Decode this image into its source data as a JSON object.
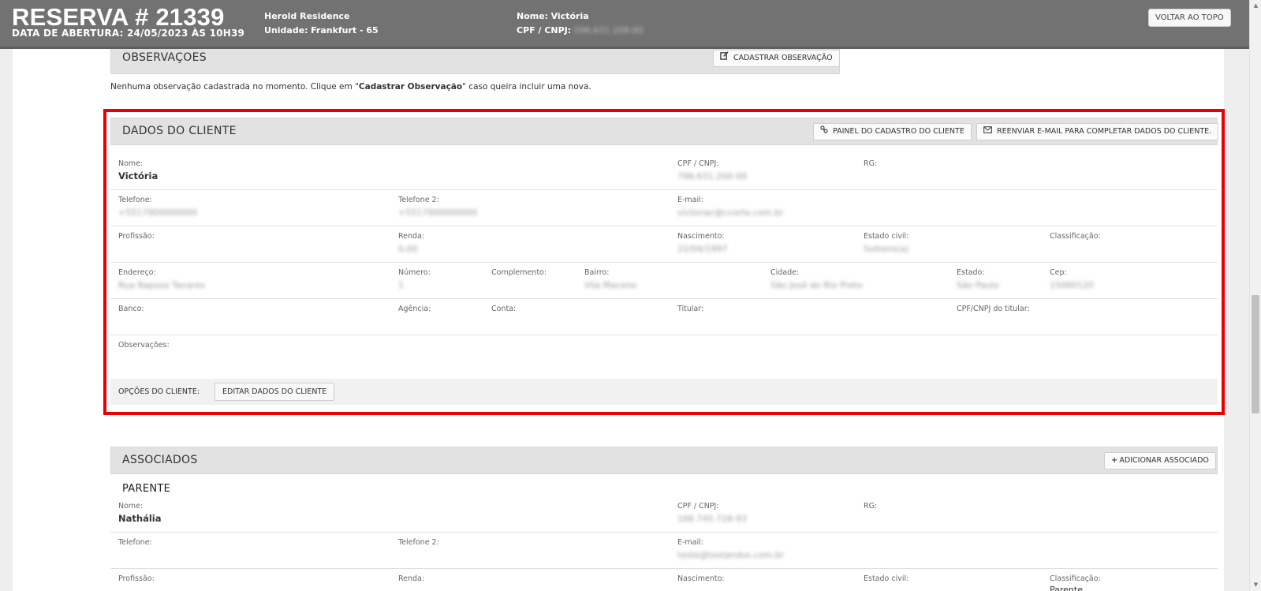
{
  "header": {
    "title": "RESERVA # 21339",
    "opened": "DATA DE ABERTURA: 24/05/2023 ÀS 10H39",
    "residence": "Herold Residence",
    "unit_label": "Unidade:",
    "unit_value": "Frankfurt - 65",
    "name_label": "Nome:",
    "name_value": "Victória",
    "cpf_label": "CPF / CNPJ:",
    "cpf_value": "096.631.208-80",
    "back_to_top": "VOLTAR AO TOPO"
  },
  "observacoes": {
    "title": "OBSERVAÇOES",
    "register_button": "CADASTRAR OBSERVAÇÃO",
    "note_prefix": "Nenhuma observação cadastrada no momento. Clique em \"",
    "note_bold": "Cadastrar Observação",
    "note_suffix": "\" caso queira incluir uma nova."
  },
  "client": {
    "title": "DADOS DO CLIENTE",
    "panel_button": "PAINEL DO CADASTRO DO CLIENTE",
    "resend_button": "REENVIAR E-MAIL PARA COMPLETAR DADOS DO CLIENTE.",
    "fields": {
      "nome_label": "Nome:",
      "nome": "Victória",
      "cpf_label": "CPF / CNPJ:",
      "cpf": "796.631.200-00",
      "rg_label": "RG:",
      "telefone_label": "Telefone:",
      "telefone": "+5517900000000",
      "telefone2_label": "Telefone 2:",
      "telefone2": "+5517900000000",
      "email_label": "E-mail:",
      "email": "victoriac@ccorte.com.br",
      "profissao_label": "Profissão:",
      "renda_label": "Renda:",
      "renda": "0,00",
      "nascimento_label": "Nascimento:",
      "nascimento": "22/04/1997",
      "estado_civil_label": "Estado civil:",
      "estado_civil": "Solteiro(a)",
      "classificacao_label": "Classificação:",
      "endereco_label": "Endereço:",
      "endereco": "Rua Raposo Tavares",
      "numero_label": "Número:",
      "numero": "1",
      "complemento_label": "Complemento:",
      "bairro_label": "Bairro:",
      "bairro": "Vila Maceno",
      "cidade_label": "Cidade:",
      "cidade": "São José do Rio Preto",
      "estado_label": "Estado:",
      "estado": "São Paulo",
      "cep_label": "Cep:",
      "cep": "15060120",
      "banco_label": "Banco:",
      "agencia_label": "Agência:",
      "conta_label": "Conta:",
      "titular_label": "Titular:",
      "cpf_titular_label": "CPF/CNPJ do titular:",
      "observacoes_label": "Observações:"
    },
    "options_label": "OPÇÕES DO CLIENTE:",
    "edit_button": "EDITAR DADOS DO CLIENTE"
  },
  "associados": {
    "title": "ASSOCIADOS",
    "add_button": "ADICIONAR ASSOCIADO",
    "subtitle": "PARENTE",
    "fields": {
      "nome_label": "Nome:",
      "nome": "Nathália",
      "cpf_label": "CPF / CNPJ:",
      "cpf": "166.745.728-93",
      "rg_label": "RG:",
      "telefone_label": "Telefone:",
      "telefone2_label": "Telefone 2:",
      "email_label": "E-mail:",
      "email": "teste@testandos.com.br",
      "profissao_label": "Profissão:",
      "renda_label": "Renda:",
      "nascimento_label": "Nascimento:",
      "estado_civil_label": "Estado civil:",
      "classificacao_label": "Classificação:",
      "classificacao": "Parente"
    }
  },
  "icons": {
    "edit": "edit-icon",
    "link": "link-icon",
    "mail": "mail-icon",
    "plus": "plus-icon"
  },
  "colors": {
    "header_bg": "#727272",
    "highlight_border": "#e90000",
    "panel_head_bg": "#e2e2e2"
  }
}
